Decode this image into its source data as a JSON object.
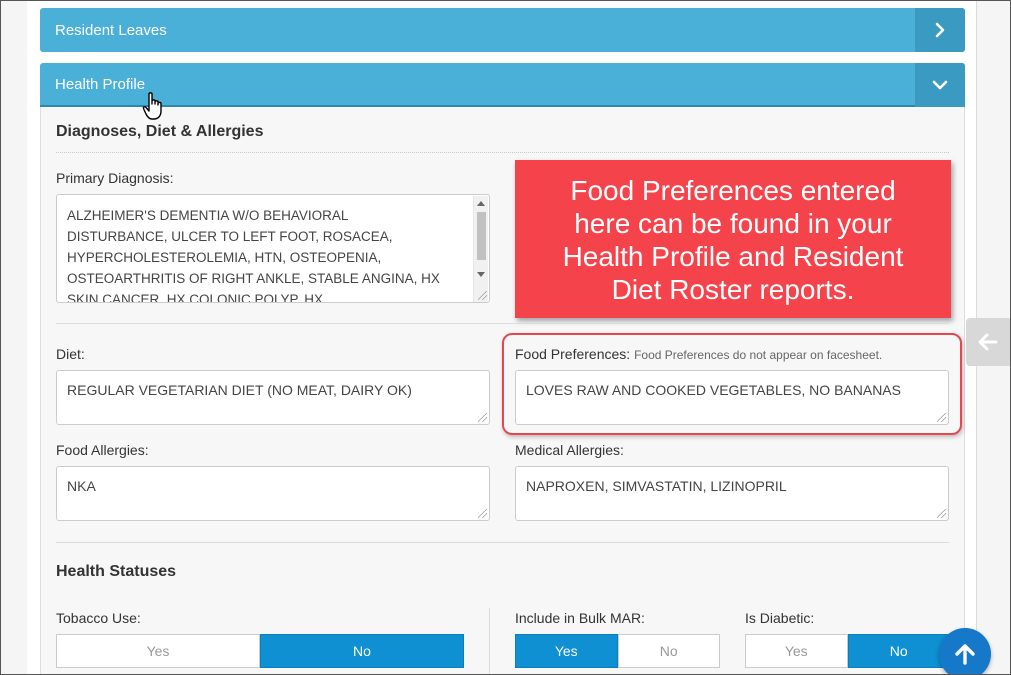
{
  "panels": {
    "resident_leaves": {
      "title": "Resident Leaves"
    },
    "health_profile": {
      "title": "Health Profile"
    }
  },
  "diagnoses": {
    "section_title": "Diagnoses, Diet & Allergies",
    "primary_diagnosis_label": "Primary Diagnosis:",
    "primary_diagnosis_lines": [
      "ALZHEIMER'S DEMENTIA W/O BEHAVIORAL",
      "DISTURBANCE, ULCER TO LEFT FOOT, ROSACEA,",
      "HYPERCHOLESTEROLEMIA, HTN, OSTEOPENIA,",
      "OSTEOARTHRITIS OF RIGHT ANKLE, STABLE ANGINA, HX",
      "SKIN CANCER, HX COLONIC POLYP, HX"
    ],
    "diet_label": "Diet:",
    "diet_value": "REGULAR VEGETARIAN DIET (NO MEAT, DAIRY OK)",
    "food_preferences_label": "Food Preferences:",
    "food_preferences_hint": "Food Preferences do not appear on facesheet.",
    "food_preferences_value": "LOVES RAW AND COOKED VEGETABLES, NO BANANAS",
    "food_allergies_label": "Food Allergies:",
    "food_allergies_value": "NKA",
    "medical_allergies_label": "Medical Allergies:",
    "medical_allergies_value": "NAPROXEN, SIMVASTATIN, LIZINOPRIL"
  },
  "callout": {
    "lines": [
      "Food Preferences entered",
      "here can be found in your",
      "Health Profile and Resident",
      "Diet Roster reports."
    ],
    "color": "#f5434b"
  },
  "health_statuses": {
    "section_title": "Health Statuses",
    "tobacco": {
      "label": "Tobacco Use:",
      "yes": "Yes",
      "no": "No",
      "selected": "No"
    },
    "bulk_mar": {
      "label": "Include in Bulk MAR:",
      "yes": "Yes",
      "no": "No",
      "selected": "Yes"
    },
    "diabetic": {
      "label": "Is Diabetic:",
      "yes": "Yes",
      "no": "No",
      "selected": "No"
    }
  },
  "colors": {
    "header_blue": "#4bb0d8",
    "toggle_active": "#0e90d2",
    "fab_blue": "#1578c9",
    "highlight_red": "#e4474e"
  },
  "icons": {
    "resident_leaves_chevron": "chevron-right-icon",
    "health_profile_chevron": "chevron-down-icon",
    "side_tab": "arrow-left-icon",
    "fab": "arrow-up-icon",
    "cursor": "hand-pointer-icon"
  }
}
